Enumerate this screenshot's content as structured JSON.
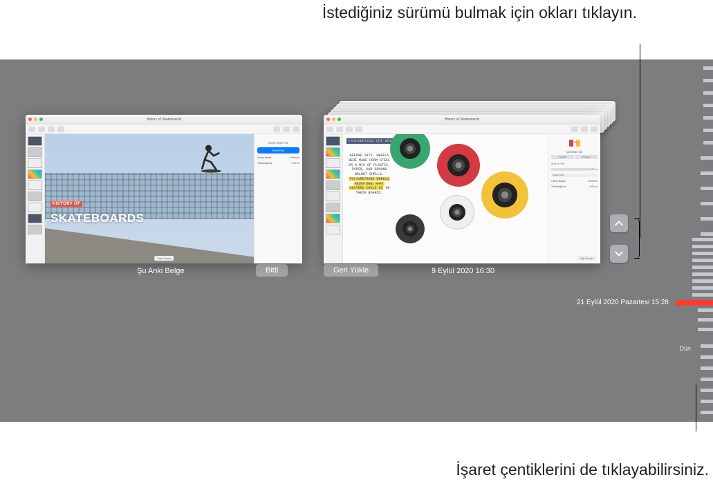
{
  "callouts": {
    "top": "İstediğiniz sürümü bulmak için okları tıklayın.",
    "bottom": "İşaret çentiklerini de tıklayabilirsiniz."
  },
  "left_doc": {
    "window_title": "History of Skateboards",
    "tag": "HISTORY OF",
    "title": "SKATEBOARDS",
    "inspector": {
      "panel_title": "Geçiş Efekti Yok",
      "primary_button": "Efekt Ekle",
      "row1_left": "Geçişi Başlat",
      "row1_right": "Gecikme",
      "row2_left": "Tıklandığında",
      "row2_right": "0,00 sn"
    },
    "slide_order_label": "Yapı Sırası"
  },
  "right_doc": {
    "window_title": "History of Skateboards",
    "banner": "reinventing the wheel",
    "body_text_lines": [
      "BEFORE 1972, WHEELS",
      "WERE MADE FROM STEEL",
      "OR A MIX OF PLASTIC,",
      "PAPER, AND GROUND",
      "WALNUT SHELLS.",
      "POLYURETHANE WHEELS",
      "REDEFINED WHAT",
      "SKATERS COULD DO",
      "ON",
      "THEIR BOARDS."
    ],
    "inspector": {
      "panel_title": "Çamaşır İpi",
      "change_button": "Değiştir",
      "preview_button": "Önizleme",
      "duration_label": "Süre ve Yön",
      "duration_value": "1,00 sn",
      "direction": "Soldan Sola",
      "row1_left": "Geçişi Başlat",
      "row1_right": "Gecikme",
      "row2_left": "Tıklandığında",
      "row2_right": "0,00 sn"
    },
    "slide_order_label": "Yapı Sırası"
  },
  "footer": {
    "current_label": "Şu Anki Belge",
    "done_button": "Bitti",
    "restore_button": "Geri Yükle",
    "version_timestamp": "9 Eylül 2020 16:30"
  },
  "timeline": {
    "current_label": "21 Eylül 2020 Pazartesi 15:28",
    "section_label": "Dün"
  },
  "icons": {
    "up": "chevron-up",
    "down": "chevron-down"
  }
}
